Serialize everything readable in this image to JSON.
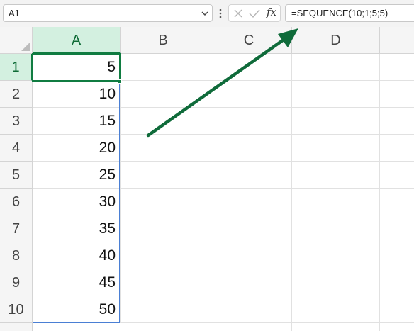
{
  "formula_bar": {
    "name_box": "A1",
    "formula": "=SEQUENCE(10;1;5;5)",
    "fx_label": "fx"
  },
  "columns": [
    "A",
    "B",
    "C",
    "D"
  ],
  "rows": [
    "1",
    "2",
    "3",
    "4",
    "5",
    "6",
    "7",
    "8",
    "9",
    "10"
  ],
  "column_a_values": [
    "5",
    "10",
    "15",
    "20",
    "25",
    "30",
    "35",
    "40",
    "45",
    "50"
  ],
  "colors": {
    "accent_green": "#107c41",
    "arrow_green": "#0f6b3a",
    "spill_border": "#4a7fd4"
  },
  "icons": {
    "name_box_dropdown": "chevron-down-icon",
    "more": "vertical-dots-icon",
    "cancel": "x-icon",
    "enter": "check-icon",
    "annotation": "arrow-icon"
  }
}
